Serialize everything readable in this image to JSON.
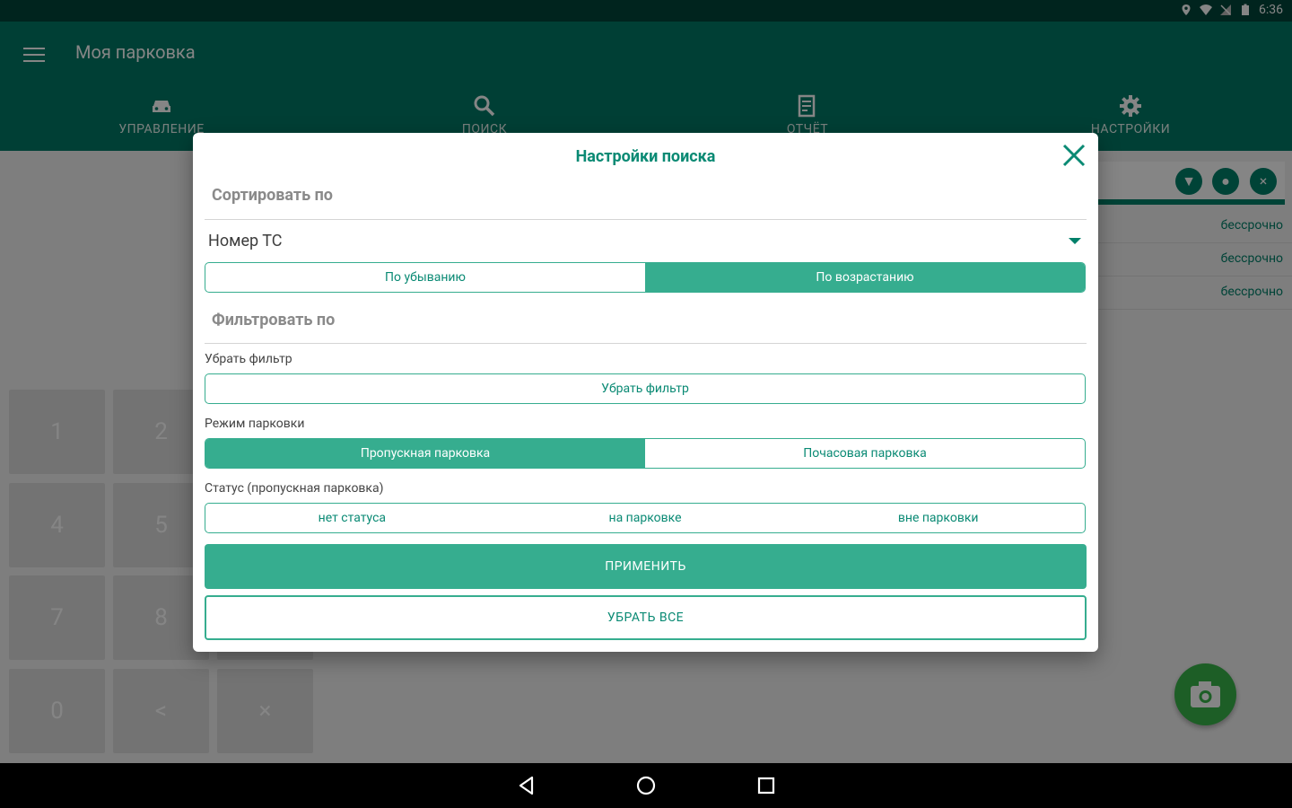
{
  "status_bar": {
    "time": "6:36"
  },
  "app_bar": {
    "title": "Моя парковка",
    "tabs": [
      {
        "label": "УПРАВЛЕНИЕ",
        "icon": "car-icon"
      },
      {
        "label": "ПОИСК",
        "icon": "search-icon"
      },
      {
        "label": "ОТЧЁТ",
        "icon": "report-icon"
      },
      {
        "label": "НАСТРОЙКИ",
        "icon": "gear-icon"
      }
    ]
  },
  "background_list": {
    "rows": [
      "бессрочно",
      "бессрочно",
      "бессрочно"
    ]
  },
  "keypad": {
    "keys": [
      "1",
      "2",
      "4",
      "5",
      "7",
      "8",
      "0",
      "<",
      "×"
    ]
  },
  "dialog": {
    "title": "Настройки поиска",
    "sort_section_title": "Сортировать по",
    "sort_field_value": "Номер ТС",
    "sort_order": {
      "options": [
        "По убыванию",
        "По возрастанию"
      ],
      "selected": "По возрастанию"
    },
    "filter_section_title": "Фильтровать по",
    "remove_filter": {
      "label": "Убрать фильтр",
      "button": "Убрать фильтр"
    },
    "parking_mode": {
      "label": "Режим парковки",
      "options": [
        "Пропускная парковка",
        "Почасовая парковка"
      ],
      "selected": "Пропускная парковка"
    },
    "status": {
      "label": "Статус (пропускная парковка)",
      "options": [
        "нет статуса",
        "на парковке",
        "вне парковки"
      ]
    },
    "apply_button": "ПРИМЕНИТЬ",
    "clear_button": "УБРАТЬ ВСЕ"
  },
  "colors": {
    "primary": "#007a66",
    "accent": "#36ad8f",
    "status_bar": "#00453a",
    "fab": "#38b54a"
  }
}
